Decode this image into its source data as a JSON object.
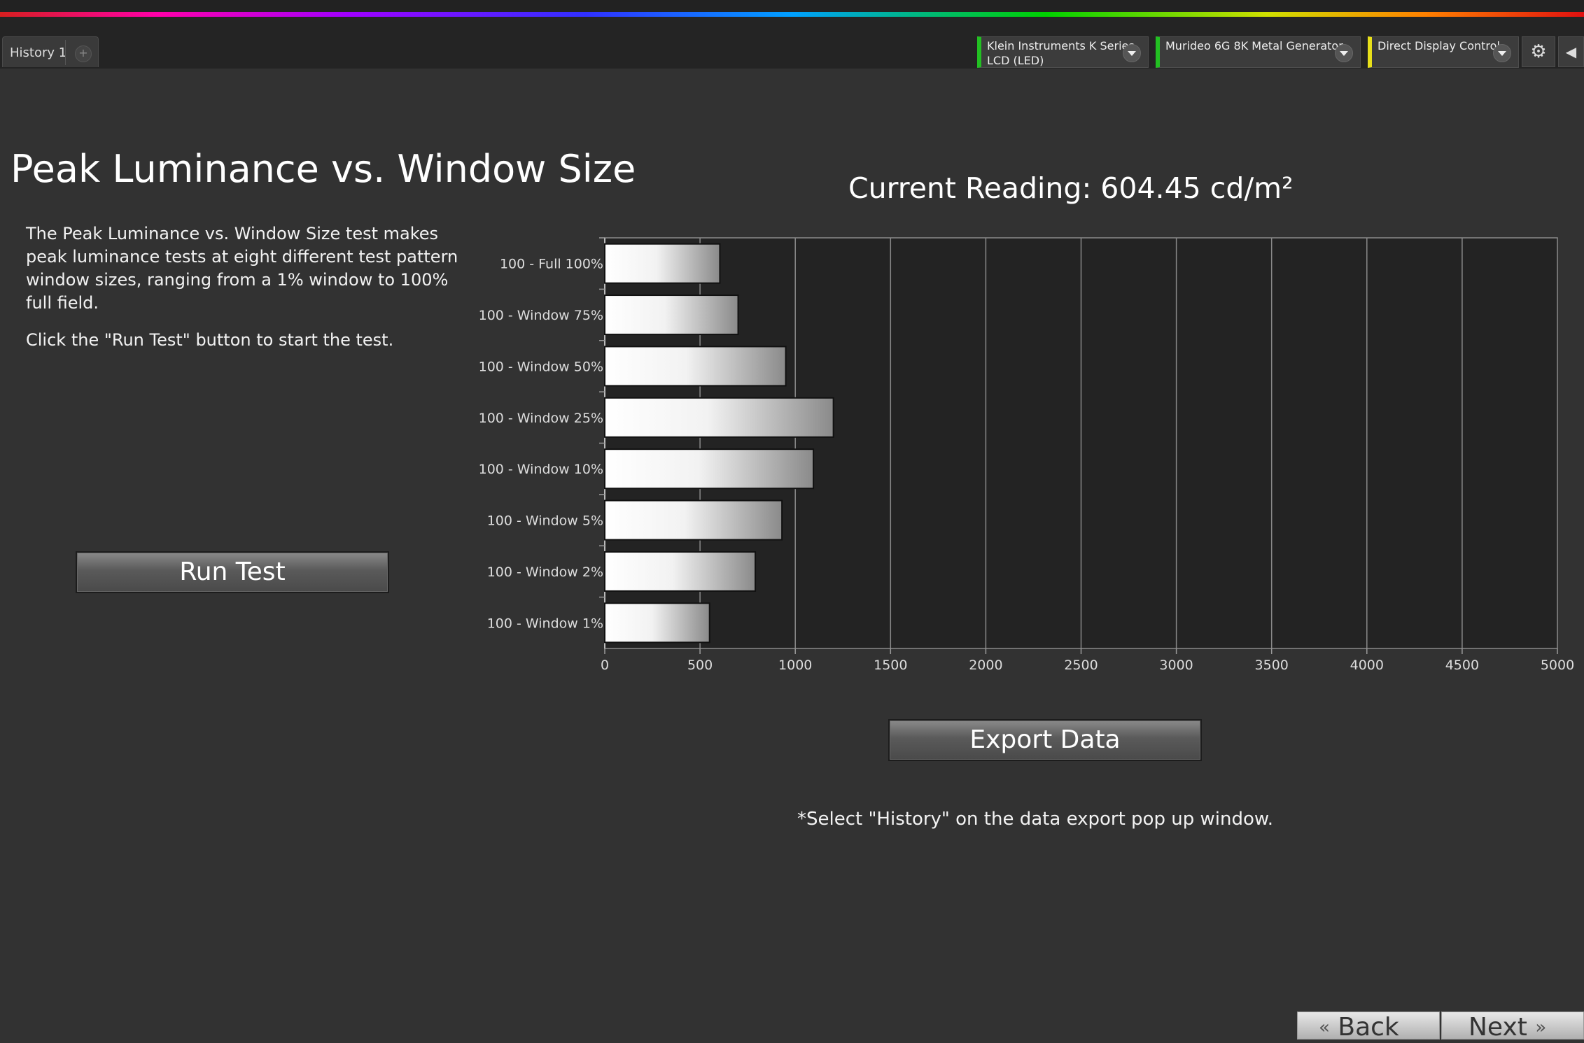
{
  "tabs": {
    "history_label": "History 1",
    "add_symbol": "+"
  },
  "devices": [
    {
      "label": "Klein Instruments K Series\nLCD (LED)",
      "color": "#22c022"
    },
    {
      "label": "Murideo 6G 8K Metal Generator",
      "color": "#22c022"
    },
    {
      "label": "Direct Display Control",
      "color": "#e8e01a"
    }
  ],
  "toolbar": {
    "settings_icon": "gear-icon",
    "collapse_icon": "chevron-left-icon"
  },
  "page": {
    "title": "Peak Luminance vs. Window Size",
    "description": "The Peak Luminance vs. Window Size test makes peak luminance tests at eight different test pattern window sizes, ranging from a 1% window to 100% full field.",
    "instruction": "Click the \"Run Test\" button to start the test."
  },
  "buttons": {
    "run_test": "Run Test",
    "export_data": "Export  Data"
  },
  "reading": {
    "text": "Current Reading: 604.45 cd/m²"
  },
  "export_note": "*Select \"History\" on the data export pop up window.",
  "nav": {
    "back": "Back",
    "next": "Next"
  },
  "chart_data": {
    "type": "bar",
    "orientation": "horizontal",
    "categories": [
      "100 - Full  100%",
      "100 - Window 75%",
      "100 - Window 50%",
      "100 - Window 25%",
      "100 - Window 10%",
      "100 - Window  5%",
      "100 - Window  2%",
      "100 - Window  1%"
    ],
    "values": [
      604,
      700,
      950,
      1200,
      1095,
      930,
      790,
      550
    ],
    "xlim": [
      0,
      5000
    ],
    "xticks": [
      0,
      500,
      1000,
      1500,
      2000,
      2500,
      3000,
      3500,
      4000,
      4500,
      5000
    ],
    "grid": true,
    "bar_style": "white-to-gray gradient"
  }
}
